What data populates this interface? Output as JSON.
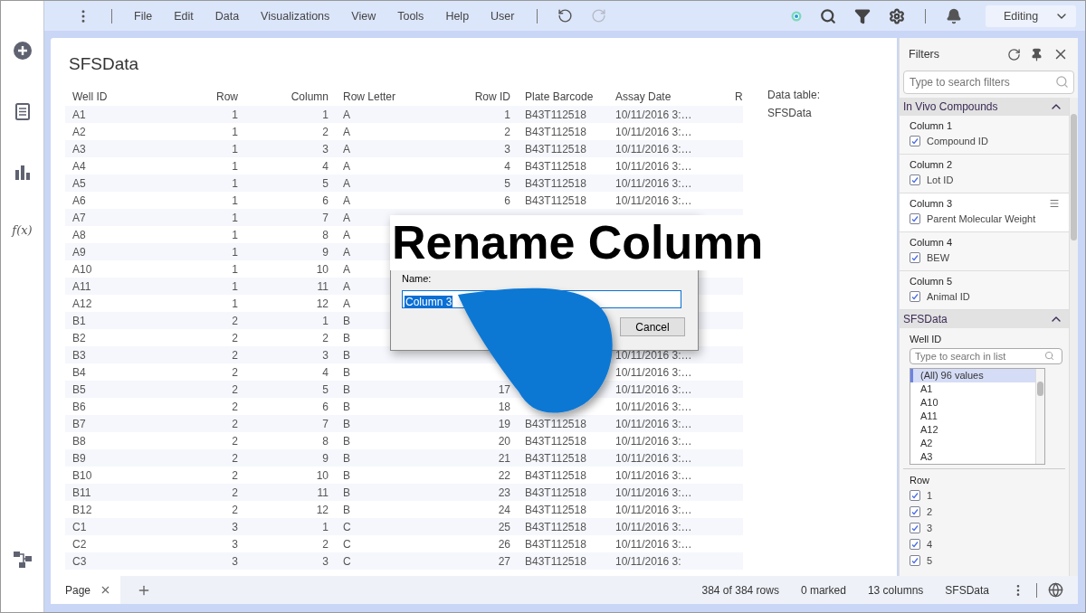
{
  "sidebar": {
    "formula_label": "f(x)"
  },
  "toolbar": {
    "menus": [
      "File",
      "Edit",
      "Data",
      "Visualizations",
      "View",
      "Tools",
      "Help",
      "User"
    ],
    "history": [
      {
        "kind": "undo",
        "disabled": false
      },
      {
        "kind": "redo",
        "disabled": true
      }
    ],
    "mode": "Editing"
  },
  "page": {
    "title": "SFSData",
    "table": {
      "columns": [
        "Well ID",
        "Row",
        "Column",
        "Row Letter",
        "Row ID",
        "Plate Barcode",
        "Assay Date",
        "R"
      ],
      "rows": [
        [
          "A1",
          "1",
          "1",
          "A",
          "1",
          "B43T112518",
          "10/11/2016 3:…"
        ],
        [
          "A2",
          "1",
          "2",
          "A",
          "2",
          "B43T112518",
          "10/11/2016 3:…"
        ],
        [
          "A3",
          "1",
          "3",
          "A",
          "3",
          "B43T112518",
          "10/11/2016 3:…"
        ],
        [
          "A4",
          "1",
          "4",
          "A",
          "4",
          "B43T112518",
          "10/11/2016 3:…"
        ],
        [
          "A5",
          "1",
          "5",
          "A",
          "5",
          "B43T112518",
          "10/11/2016 3:…"
        ],
        [
          "A6",
          "1",
          "6",
          "A",
          "6",
          "B43T112518",
          "10/11/2016 3:…"
        ],
        [
          "A7",
          "1",
          "7",
          "A",
          null,
          null,
          null
        ],
        [
          "A8",
          "1",
          "8",
          "A",
          null,
          null,
          null
        ],
        [
          "A9",
          "1",
          "9",
          "A",
          null,
          null,
          null
        ],
        [
          "A10",
          "1",
          "10",
          "A",
          null,
          null,
          null
        ],
        [
          "A11",
          "1",
          "11",
          "A",
          null,
          null,
          null
        ],
        [
          "A12",
          "1",
          "12",
          "A",
          null,
          null,
          null
        ],
        [
          "B1",
          "2",
          "1",
          "B",
          null,
          null,
          null
        ],
        [
          "B2",
          "2",
          "2",
          "B",
          null,
          null,
          null
        ],
        [
          "B3",
          "2",
          "3",
          "B",
          null,
          null,
          "10/11/2016 3:…"
        ],
        [
          "B4",
          "2",
          "4",
          "B",
          null,
          null,
          "10/11/2016 3:…"
        ],
        [
          "B5",
          "2",
          "5",
          "B",
          "17",
          null,
          "10/11/2016 3:…"
        ],
        [
          "B6",
          "2",
          "6",
          "B",
          "18",
          null,
          "10/11/2016 3:…"
        ],
        [
          "B7",
          "2",
          "7",
          "B",
          "19",
          "B43T112518",
          "10/11/2016 3:…"
        ],
        [
          "B8",
          "2",
          "8",
          "B",
          "20",
          "B43T112518",
          "10/11/2016 3:…"
        ],
        [
          "B9",
          "2",
          "9",
          "B",
          "21",
          "B43T112518",
          "10/11/2016 3:…"
        ],
        [
          "B10",
          "2",
          "10",
          "B",
          "22",
          "B43T112518",
          "10/11/2016 3:…"
        ],
        [
          "B11",
          "2",
          "11",
          "B",
          "23",
          "B43T112518",
          "10/11/2016 3:…"
        ],
        [
          "B12",
          "2",
          "12",
          "B",
          "24",
          "B43T112518",
          "10/11/2016 3:…"
        ],
        [
          "C1",
          "3",
          "1",
          "C",
          "25",
          "B43T112518",
          "10/11/2016 3:…"
        ],
        [
          "C2",
          "3",
          "2",
          "C",
          "26",
          "B43T112518",
          "10/11/2016 3:…"
        ],
        [
          "C3",
          "3",
          "3",
          "C",
          "27",
          "B43T112518",
          "10/11/2016 3:"
        ]
      ]
    },
    "info": {
      "label": "Data table:",
      "value": "SFSData"
    }
  },
  "dialog": {
    "heading": "Rename Column",
    "name_label": "Name:",
    "name_value": "Column 3",
    "cancel": "Cancel"
  },
  "filters": {
    "title": "Filters",
    "search_placeholder": "Type to search filters",
    "groups": [
      {
        "kind": "columns",
        "title": "In Vivo Compounds",
        "expanded": true,
        "columns": [
          {
            "label": "Column 1",
            "item": "Compound ID",
            "checked": true,
            "selected": false
          },
          {
            "label": "Column 2",
            "item": "Lot ID",
            "checked": true,
            "selected": false
          },
          {
            "label": "Column 3",
            "item": "Parent Molecular Weight",
            "checked": true,
            "selected": true
          },
          {
            "label": "Column 4",
            "item": "BEW",
            "checked": true,
            "selected": false
          },
          {
            "label": "Column 5",
            "item": "Animal ID",
            "checked": true,
            "selected": false
          }
        ]
      },
      {
        "kind": "filters",
        "title": "SFSData",
        "expanded": true,
        "list_filter": {
          "label": "Well ID",
          "placeholder": "Type to search in list",
          "values": [
            {
              "label": "(All) 96 values",
              "selected": true
            },
            {
              "label": "A1",
              "selected": false
            },
            {
              "label": "A10",
              "selected": false
            },
            {
              "label": "A11",
              "selected": false
            },
            {
              "label": "A12",
              "selected": false
            },
            {
              "label": "A2",
              "selected": false
            },
            {
              "label": "A3",
              "selected": false
            }
          ]
        },
        "check_filter": {
          "label": "Row",
          "options": [
            {
              "label": "1",
              "checked": true
            },
            {
              "label": "2",
              "checked": true
            },
            {
              "label": "3",
              "checked": true
            },
            {
              "label": "4",
              "checked": true
            },
            {
              "label": "5",
              "checked": true
            }
          ]
        }
      }
    ]
  },
  "tabs": [
    {
      "label": "Page",
      "selected": true
    }
  ],
  "status_bar": [
    "384 of 384 rows",
    "0 marked",
    "13 columns",
    "SFSData"
  ]
}
